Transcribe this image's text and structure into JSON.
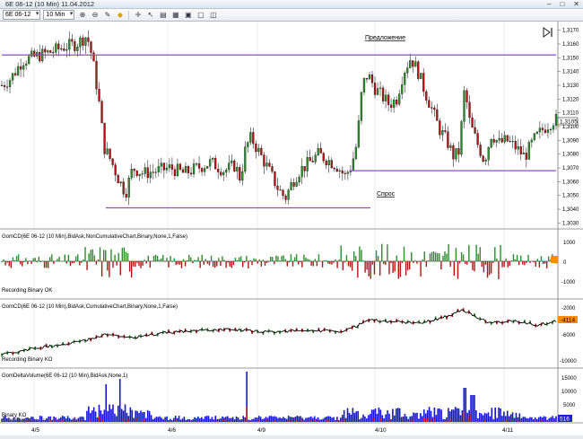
{
  "window": {
    "title": "6E 06-12 (10 Min)  11.04.2012",
    "controls": [
      "minimize-icon",
      "maximize-icon",
      "close-icon"
    ]
  },
  "toolbar": {
    "instrument": "6E 06-12",
    "interval": "10 Min",
    "icons": [
      "zoom-in-icon",
      "zoom-out-icon",
      "pencil-icon",
      "color-icon",
      "crosshair-icon",
      "pointer-icon",
      "properties-icon",
      "grid-icon",
      "screenshot-icon",
      "window-icon",
      "layout-icon"
    ]
  },
  "main_panel": {
    "annotation_top": "Предложение",
    "annotation_bottom": "Спрос",
    "y_ticks": [
      "1,3170",
      "1,3160",
      "1,3150",
      "1,3140",
      "1,3130",
      "1,3120",
      "1,3110",
      "1,3100",
      "1,3090",
      "1,3080",
      "1,3070",
      "1,3060",
      "1,3050",
      "1,3040",
      "1,3030"
    ],
    "price_badge": "1,3105",
    "resistance_level": 1.3152,
    "support_level_upper": 1.3068,
    "support_level_lower": 1.3041
  },
  "panel2": {
    "label": "GomCD(6E 06-12 (10 Min),BidAsk,NonCumulativeChart,Binary,None,1,False)",
    "status": "Recording Binary OK",
    "y_ticks": [
      "1000",
      "0",
      "-1000"
    ]
  },
  "panel3": {
    "label": "GomCD(6E 06-12 (10 Min),BidAsk,CumulativeChart,Binary,None,1,False)",
    "status": "Recording Binary KO",
    "y_ticks": [
      "-2000",
      "-6000",
      "-10000"
    ],
    "value_badge": "-4114"
  },
  "panel4": {
    "label": "GomDeltaVolume(6E 06-12 (10 Min),BidAsk,None,1)",
    "status": "Binary KO",
    "copyright": "© 2012 NinjaTrader, LLC",
    "y_ticks": [
      "15000",
      "10000",
      "5000"
    ],
    "value_badge": "516"
  },
  "x_axis": {
    "labels": [
      "4/5",
      "4/6",
      "4/9",
      "4/10",
      "4/11"
    ]
  },
  "colors": {
    "up_candle": "#2e8b2e",
    "down_candle": "#b01414",
    "level_line": "#8a4ce0",
    "volume": "#1414d2",
    "badge": "#ff8c00",
    "gridline": "#e2e2e2"
  }
}
